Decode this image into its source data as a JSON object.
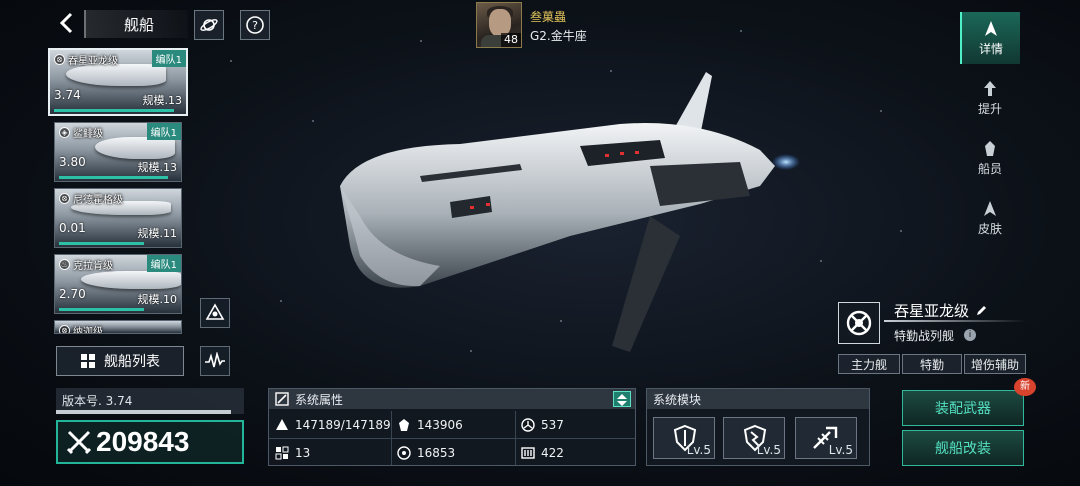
{
  "header": {
    "title": "舰船"
  },
  "commander": {
    "name": "叁菓蟲",
    "level": "48",
    "rank": "G2.金牛座"
  },
  "ship_cards": [
    {
      "name": "吞星亚龙级",
      "fleet": "编队1",
      "level": "3.74",
      "scale": "规模.13",
      "selected": true,
      "progress": 0.92
    },
    {
      "name": "鲨鲱级",
      "fleet": "编队1",
      "level": "3.80",
      "scale": "规模.13",
      "selected": false,
      "progress": 0.9
    },
    {
      "name": "尼德霍格级",
      "fleet": "",
      "level": "0.01",
      "scale": "规模.11",
      "selected": false,
      "progress": 0.7
    },
    {
      "name": "克拉肯级",
      "fleet": "编队1",
      "level": "2.70",
      "scale": "规模.10",
      "selected": false,
      "progress": 0.7
    },
    {
      "name": "纳迦级",
      "fleet": "",
      "level": "",
      "scale": "",
      "selected": false,
      "progress": 0
    }
  ],
  "ship_list_button": "舰船列表",
  "version": {
    "label": "版本号. 3.74",
    "progress": 0.93
  },
  "power": {
    "value": "209843"
  },
  "attributes": {
    "title": "系统属性",
    "items": [
      {
        "icon": "hull-icon",
        "value": "147189/147189"
      },
      {
        "icon": "armor-icon",
        "value": "143906"
      },
      {
        "icon": "shield-icon",
        "value": "537"
      },
      {
        "icon": "speed-icon",
        "value": "13"
      },
      {
        "icon": "target-icon",
        "value": "16853"
      },
      {
        "icon": "ammo-icon",
        "value": "422"
      }
    ]
  },
  "modules": {
    "title": "系统模块",
    "slots": [
      {
        "icon": "shield-module-icon",
        "level": "Lv.5"
      },
      {
        "icon": "shield-break-module-icon",
        "level": "Lv.5"
      },
      {
        "icon": "weapon-module-icon",
        "level": "Lv.5"
      }
    ]
  },
  "actions": {
    "equip_weapon": "装配武器",
    "modify_ship": "舰船改装",
    "new_badge": "新"
  },
  "right_nav": [
    {
      "label": "详情",
      "active": true
    },
    {
      "label": "提升",
      "active": false
    },
    {
      "label": "船员",
      "active": false
    },
    {
      "label": "皮肤",
      "active": false
    }
  ],
  "ship_info": {
    "name": "吞星亚龙级",
    "class": "特勤战列舰",
    "tags": [
      "主力舰",
      "特勤",
      "增伤辅助"
    ]
  },
  "colors": {
    "accent": "#2cc0a6",
    "gold": "#e2c35a",
    "badge": "#d8432e"
  }
}
